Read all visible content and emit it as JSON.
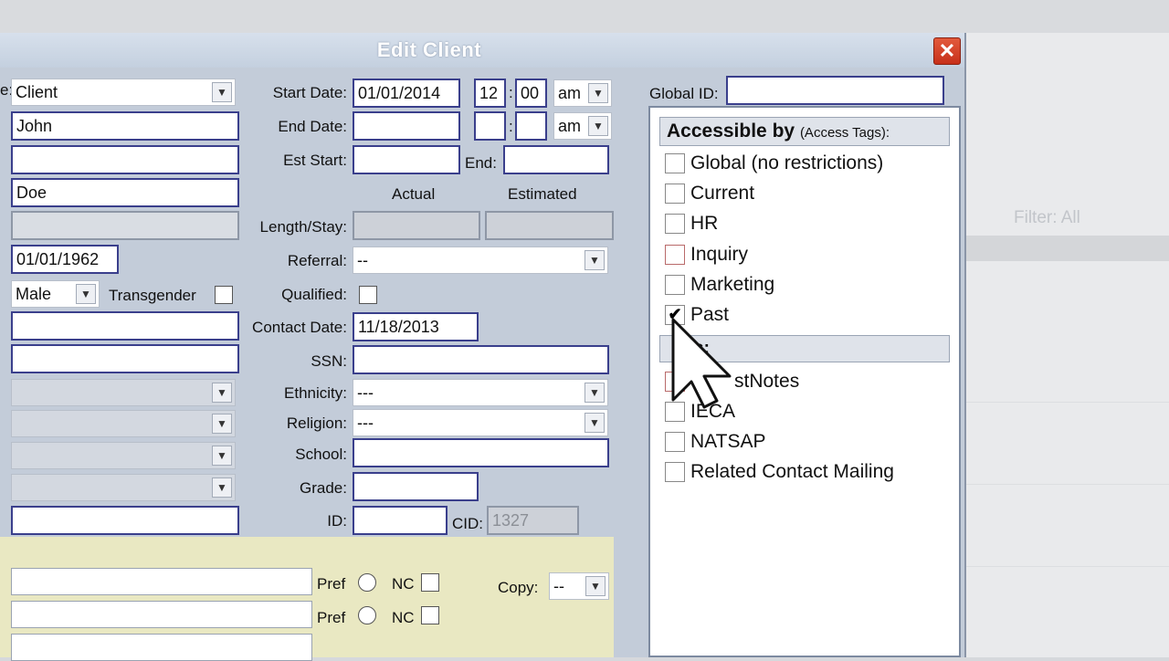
{
  "background": {
    "filter_text": "Filter: All"
  },
  "dialog": {
    "title": "Edit Client",
    "close_symbol": "✕"
  },
  "left_col": {
    "type_value": "Client",
    "first_name": "John",
    "last_name": "Doe",
    "dob": "01/01/1962",
    "gender": "Male",
    "transgender_label": "Transgender"
  },
  "mid_col": {
    "start_date_label": "Start Date:",
    "start_date": "01/01/2014",
    "start_hour": "12",
    "start_min": "00",
    "start_ampm": "am",
    "end_date_label": "End Date:",
    "end_ampm": "am",
    "est_start_label": "Est Start:",
    "end_label": "End:",
    "actual_label": "Actual",
    "estimated_label": "Estimated",
    "length_stay_label": "Length/Stay:",
    "referral_label": "Referral:",
    "referral_value": "--",
    "qualified_label": "Qualified:",
    "contact_date_label": "Contact Date:",
    "contact_date": "11/18/2013",
    "ssn_label": "SSN:",
    "ethnicity_label": "Ethnicity:",
    "ethnicity_value": "---",
    "religion_label": "Religion:",
    "religion_value": "---",
    "school_label": "School:",
    "grade_label": "Grade:",
    "id_label": "ID:",
    "cid_label": "CID:",
    "cid_value": "1327"
  },
  "contact_rows": {
    "pref_label": "Pref",
    "nc_label": "NC",
    "copy_label": "Copy:",
    "copy_value": "--"
  },
  "right_panel": {
    "global_id_label": "Global ID:",
    "tags_header": "Accessible by",
    "tags_header_small": "(Access Tags):",
    "tags": [
      {
        "label": "Global (no restrictions)",
        "checked": false
      },
      {
        "label": "Current",
        "checked": false
      },
      {
        "label": "HR",
        "checked": false
      },
      {
        "label": "Inquiry",
        "checked": false
      },
      {
        "label": "Marketing",
        "checked": false
      },
      {
        "label": "Past",
        "checked": true
      }
    ],
    "notes_header": "s:",
    "lists": [
      {
        "label": "stNotes"
      },
      {
        "label": "IECA"
      },
      {
        "label": "NATSAP"
      },
      {
        "label": "Related Contact Mailing"
      }
    ]
  }
}
